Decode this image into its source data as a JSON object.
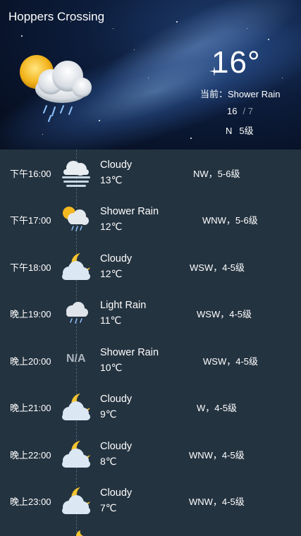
{
  "location": "Hoppers Crossing",
  "current": {
    "temperature": "16°",
    "condition_prefix": "当前：",
    "condition": "Shower Rain",
    "high": "16",
    "low": "/ 7",
    "wind_direction": "N",
    "wind_level": "5级",
    "icon": "sun-cloud-rain-icon"
  },
  "hourly": [
    {
      "time": "下午16:00",
      "condition": "Cloudy",
      "temp": "13℃",
      "wind": "NW，5-6级",
      "icon": "fog-cloud-icon"
    },
    {
      "time": "下午17:00",
      "condition": "Shower Rain",
      "temp": "12℃",
      "wind": "WNW，5-6级",
      "icon": "sun-cloud-rain-icon"
    },
    {
      "time": "下午18:00",
      "condition": "Cloudy",
      "temp": "12℃",
      "wind": "WSW，4-5级",
      "icon": "moon-cloud-icon"
    },
    {
      "time": "晚上19:00",
      "condition": "Light Rain",
      "temp": "11℃",
      "wind": "WSW，4-5级",
      "icon": "cloud-rain-icon"
    },
    {
      "time": "晚上20:00",
      "condition": "Shower Rain",
      "temp": "10℃",
      "wind": "WSW，4-5级",
      "icon": "na-icon",
      "icon_text": "N/A"
    },
    {
      "time": "晚上21:00",
      "condition": "Cloudy",
      "temp": "9℃",
      "wind": "W，4-5级",
      "icon": "moon-cloud-icon"
    },
    {
      "time": "晚上22:00",
      "condition": "Cloudy",
      "temp": "8℃",
      "wind": "WNW，4-5级",
      "icon": "moon-cloud-icon"
    },
    {
      "time": "晚上23:00",
      "condition": "Cloudy",
      "temp": "7℃",
      "wind": "WNW，4-5级",
      "icon": "moon-cloud-icon"
    }
  ]
}
